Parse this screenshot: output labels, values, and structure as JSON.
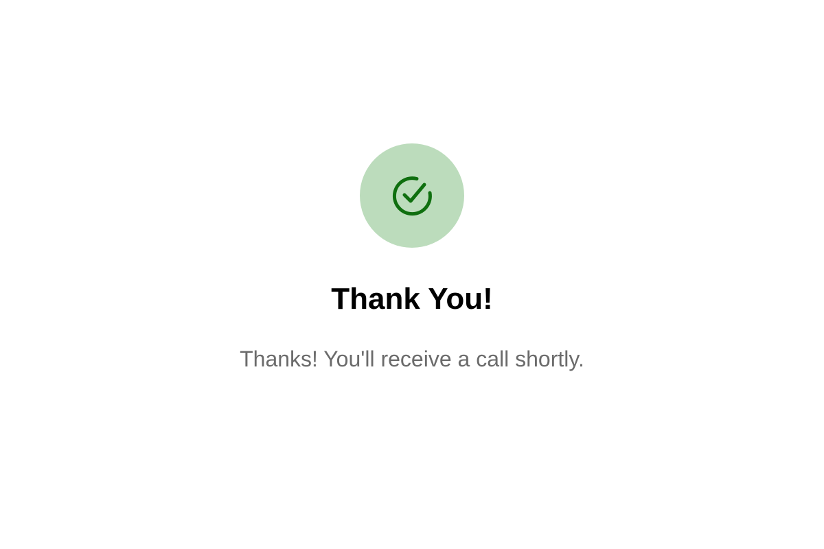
{
  "confirmation": {
    "icon": "check-circle-icon",
    "title": "Thank You!",
    "message": "Thanks! You'll receive a call shortly."
  },
  "colors": {
    "background": "#ffffff",
    "icon_background": "#bcdcbc",
    "icon_stroke": "#0f6f0f",
    "title": "#000000",
    "message": "#6b6b6b"
  }
}
